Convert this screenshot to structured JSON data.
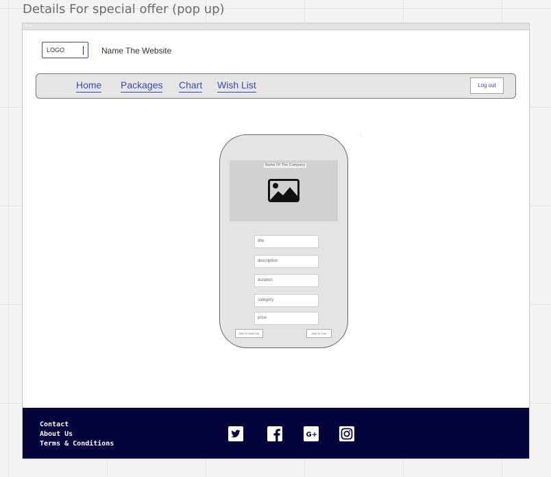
{
  "board": {
    "title": "Details For special offer (pop up)"
  },
  "header": {
    "logo_label": "LOGO",
    "site_name": "Name The Website"
  },
  "nav": {
    "links": [
      "Home",
      "Packages",
      "Chart",
      "Wish List"
    ],
    "logout_label": "Log out"
  },
  "popup": {
    "company_name": "Name Of The Company",
    "image_icon": "image-icon",
    "fields": [
      "title",
      "description",
      "duration",
      "category",
      "price"
    ],
    "left_button_label": "Add To Wish List",
    "right_button_label": "Add To Cart"
  },
  "footer": {
    "links": [
      "Contact",
      "About Us",
      "Terms & Conditions"
    ],
    "social_icons": [
      "twitter-icon",
      "facebook-icon",
      "google-plus-icon",
      "instagram-icon"
    ]
  },
  "colors": {
    "accent": "#3f4aa8",
    "footer_bg": "#04033a",
    "nav_bg": "#e6e6e6",
    "popup_bg": "#e4e4e4"
  }
}
